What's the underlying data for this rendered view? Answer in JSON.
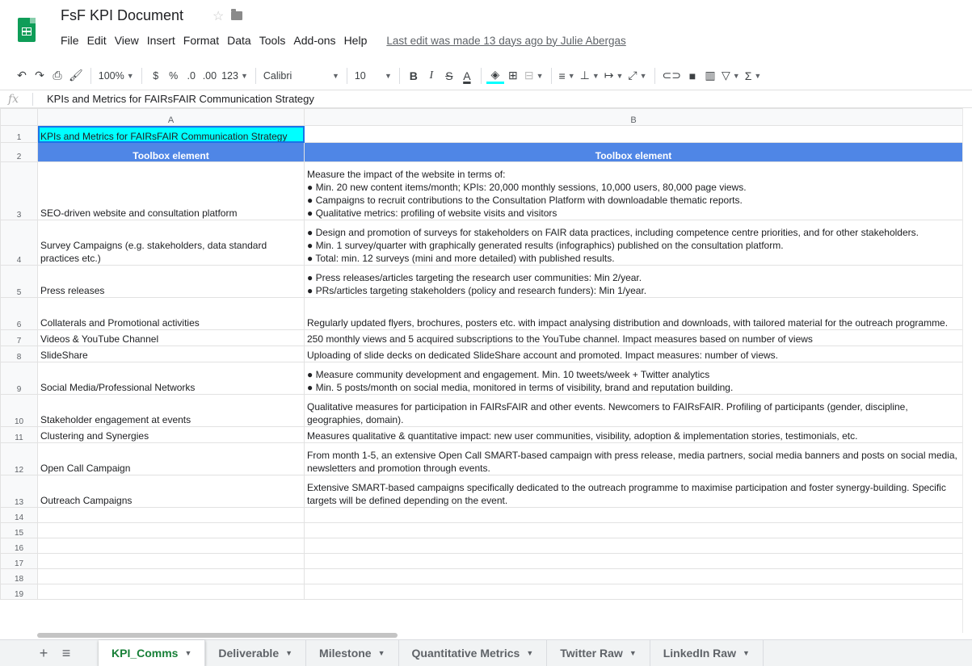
{
  "header": {
    "title": "FsF KPI Document",
    "menu": [
      "File",
      "Edit",
      "View",
      "Insert",
      "Format",
      "Data",
      "Tools",
      "Add-ons",
      "Help"
    ],
    "last_edit": "Last edit was made 13 days ago by Julie Abergas"
  },
  "toolbar": {
    "zoom": "100%",
    "currency": "$",
    "percent": "%",
    "dec_decrease": ".0",
    "dec_increase": ".00",
    "more_formats": "123",
    "font": "Calibri",
    "font_size": "10",
    "bold": "B",
    "italic": "I",
    "strike": "S",
    "text_color": "A"
  },
  "formula_bar": {
    "fx": "fx",
    "value": "KPIs and Metrics for FAIRsFAIR Communication Strategy"
  },
  "columns": [
    "A",
    "B"
  ],
  "rows": [
    {
      "n": "1",
      "a": "KPIs and Metrics for FAIRsFAIR Communication Strategy",
      "b": []
    },
    {
      "n": "2",
      "a": "Toolbox element",
      "b": [
        "Toolbox element"
      ]
    },
    {
      "n": "3",
      "a": "SEO-driven website and consultation platform",
      "b": [
        "Measure the impact of the website in terms of:",
        "● Min. 20 new content items/month; KPIs: 20,000 monthly sessions, 10,000 users, 80,000 page views.",
        "● Campaigns to recruit contributions to the Consultation Platform with downloadable thematic reports.",
        "● Qualitative metrics: profiling of website visits and visitors"
      ]
    },
    {
      "n": "4",
      "a": "Survey Campaigns (e.g. stakeholders, data standard practices etc.)",
      "b": [
        "● Design and promotion of surveys for stakeholders on FAIR data practices, including competence centre priorities, and for other stakeholders.",
        "● Min. 1 survey/quarter with graphically generated results (infographics) published on the consultation platform.",
        "● Total: min. 12 surveys (mini and more detailed) with published results."
      ]
    },
    {
      "n": "5",
      "a": "Press releases",
      "b": [
        "● Press releases/articles targeting the research user communities: Min 2/year.",
        "● PRs/articles targeting stakeholders (policy and research funders): Min 1/year."
      ]
    },
    {
      "n": "6",
      "a": "Collaterals and Promotional activities",
      "b": [
        "Regularly updated flyers, brochures, posters etc. with impact analysing distribution and downloads, with tailored material for the outreach programme."
      ]
    },
    {
      "n": "7",
      "a": "Videos & YouTube Channel",
      "b": [
        "250 monthly views and 5 acquired subscriptions to the YouTube channel. Impact measures based on number of views"
      ]
    },
    {
      "n": "8",
      "a": "SlideShare",
      "b": [
        "Uploading of slide decks on dedicated SlideShare account and promoted. Impact measures: number of views."
      ]
    },
    {
      "n": "9",
      "a": "Social Media/Professional Networks",
      "b": [
        "● Measure community development and engagement. Min. 10 tweets/week + Twitter analytics",
        "● Min. 5 posts/month on social media, monitored in terms of visibility, brand and reputation building."
      ]
    },
    {
      "n": "10",
      "a": "Stakeholder engagement at events",
      "b": [
        "Qualitative measures for participation in FAIRsFAIR and other events. Newcomers to FAIRsFAIR. Profiling of participants (gender, discipline, geographies, domain)."
      ]
    },
    {
      "n": "11",
      "a": "Clustering and Synergies",
      "b": [
        "Measures qualitative & quantitative impact: new user communities, visibility, adoption & implementation stories, testimonials, etc."
      ]
    },
    {
      "n": "12",
      "a": "Open Call Campaign",
      "b": [
        "From month 1-5, an extensive Open Call SMART-based campaign with press release, media partners, social media banners and posts on social media, newsletters and promotion through events."
      ]
    },
    {
      "n": "13",
      "a": "Outreach Campaigns",
      "b": [
        "Extensive SMART-based campaigns specifically dedicated to the outreach programme to maximise participation and foster synergy-building. Specific targets will be defined depending on the event."
      ]
    },
    {
      "n": "14",
      "a": "",
      "b": []
    },
    {
      "n": "15",
      "a": "",
      "b": []
    },
    {
      "n": "16",
      "a": "",
      "b": []
    },
    {
      "n": "17",
      "a": "",
      "b": []
    },
    {
      "n": "18",
      "a": "",
      "b": []
    },
    {
      "n": "19",
      "a": "",
      "b": []
    }
  ],
  "tabs": [
    {
      "label": "KPI_Comms",
      "active": true
    },
    {
      "label": "Deliverable",
      "active": false
    },
    {
      "label": "Milestone",
      "active": false
    },
    {
      "label": "Quantitative Metrics",
      "active": false
    },
    {
      "label": "Twitter Raw",
      "active": false
    },
    {
      "label": "LinkedIn Raw",
      "active": false
    }
  ],
  "colors": {
    "header_fill": "#4f86e6",
    "title_fill": "#00ffff",
    "active_tab": "#188038",
    "logo": "#0f9d58"
  }
}
